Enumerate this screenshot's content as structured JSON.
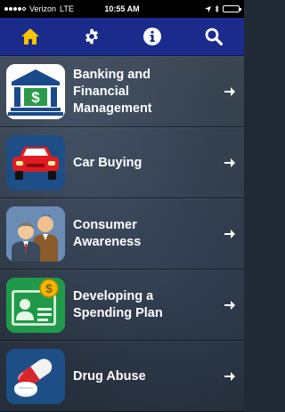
{
  "status_bar": {
    "carrier": "Verizon",
    "network": "LTE",
    "time": "10:55 AM"
  },
  "navbar": {
    "buttons": [
      {
        "icon": "home-icon",
        "color": "#f7c300"
      },
      {
        "icon": "gear-icon",
        "color": "#ffffff"
      },
      {
        "icon": "info-icon",
        "color": "#ffffff"
      },
      {
        "icon": "search-icon",
        "color": "#ffffff"
      }
    ]
  },
  "menu": {
    "items": [
      {
        "label": "Banking and\nFinancial\nManagement",
        "icon": "bank-icon"
      },
      {
        "label": "Car Buying",
        "icon": "car-icon"
      },
      {
        "label": "Consumer\nAwareness",
        "icon": "people-icon"
      },
      {
        "label": "Developing a\nSpending Plan",
        "icon": "id-card-icon"
      },
      {
        "label": "Drug Abuse",
        "icon": "pill-icon"
      }
    ]
  }
}
